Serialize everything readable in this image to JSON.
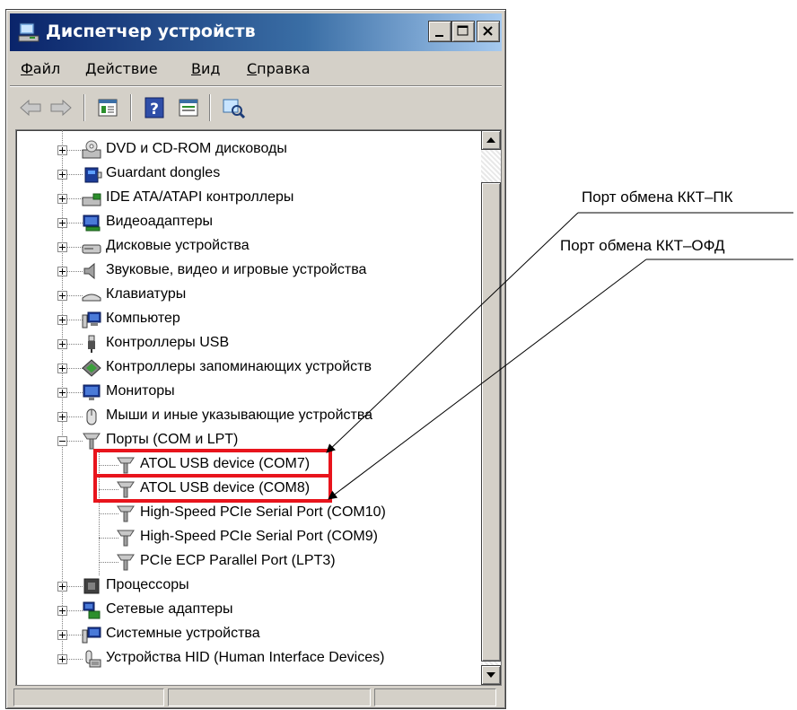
{
  "window": {
    "title": "Диспетчер устройств"
  },
  "menu": [
    {
      "label": "Файл",
      "underline": "Ф",
      "rest": "айл"
    },
    {
      "label": "Действие",
      "underline": "Д",
      "rest": "ействие"
    },
    {
      "label": "Вид",
      "underline": "В",
      "rest": "ид"
    },
    {
      "label": "Справка",
      "underline": "С",
      "rest": "правка"
    }
  ],
  "toolbar": {
    "icons": [
      "back-arrow-icon",
      "forward-arrow-icon",
      "properties-icon",
      "help-icon",
      "view-icon",
      "scan-hardware-icon"
    ]
  },
  "tree": {
    "categories": [
      {
        "label": "DVD и CD-ROM дисководы",
        "icon": "dvd-drive-icon",
        "expanded": false
      },
      {
        "label": "Guardant dongles",
        "icon": "dongle-icon",
        "expanded": false
      },
      {
        "label": "IDE ATA/ATAPI контроллеры",
        "icon": "ide-controller-icon",
        "expanded": false
      },
      {
        "label": "Видеоадаптеры",
        "icon": "display-adapter-icon",
        "expanded": false
      },
      {
        "label": "Дисковые устройства",
        "icon": "disk-drive-icon",
        "expanded": false
      },
      {
        "label": "Звуковые, видео и игровые устройства",
        "icon": "speaker-icon",
        "expanded": false
      },
      {
        "label": "Клавиатуры",
        "icon": "keyboard-icon",
        "expanded": false
      },
      {
        "label": "Компьютер",
        "icon": "computer-icon",
        "expanded": false
      },
      {
        "label": "Контроллеры USB",
        "icon": "usb-icon",
        "expanded": false
      },
      {
        "label": "Контроллеры запоминающих устройств",
        "icon": "storage-controller-icon",
        "expanded": false
      },
      {
        "label": "Мониторы",
        "icon": "monitor-icon",
        "expanded": false
      },
      {
        "label": "Мыши и иные указывающие устройства",
        "icon": "mouse-icon",
        "expanded": false
      },
      {
        "label": "Порты (COM и LPT)",
        "icon": "port-icon",
        "expanded": true,
        "children": [
          {
            "label": "ATOL USB device (COM7)",
            "icon": "port-icon",
            "highlighted": true
          },
          {
            "label": "ATOL USB device (COM8)",
            "icon": "port-icon",
            "highlighted": true
          },
          {
            "label": "High-Speed PCIe Serial Port (COM10)",
            "icon": "port-icon"
          },
          {
            "label": "High-Speed PCIe Serial Port (COM9)",
            "icon": "port-icon"
          },
          {
            "label": "PCIe ECP Parallel Port (LPT3)",
            "icon": "port-icon"
          }
        ]
      },
      {
        "label": "Процессоры",
        "icon": "processor-icon",
        "expanded": false
      },
      {
        "label": "Сетевые адаптеры",
        "icon": "network-adapter-icon",
        "expanded": false
      },
      {
        "label": "Системные устройства",
        "icon": "system-device-icon",
        "expanded": false
      },
      {
        "label": "Устройства HID (Human Interface Devices)",
        "icon": "hid-icon",
        "expanded": false
      }
    ]
  },
  "callouts": [
    {
      "label": "Порт обмена ККТ–ПК"
    },
    {
      "label": "Порт обмена ККТ–ОФД"
    }
  ],
  "colors": {
    "title_gradient_start": "#0a246a",
    "title_gradient_end": "#a6caf0",
    "highlight": "#e8141c",
    "window_face": "#d4d0c8"
  }
}
